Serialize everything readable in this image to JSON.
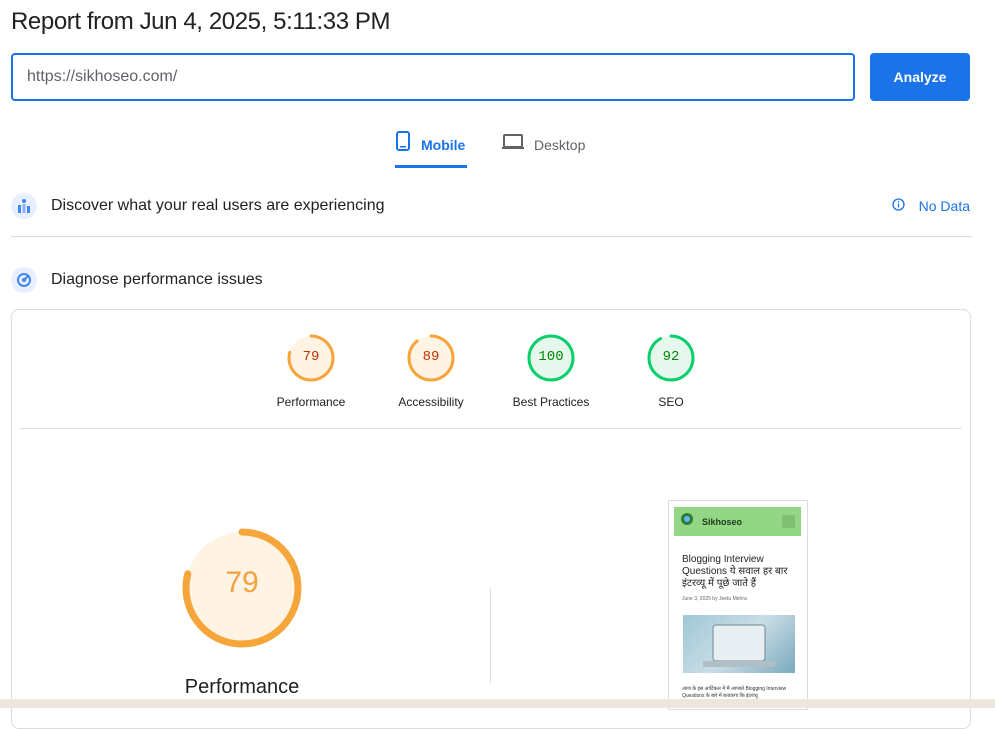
{
  "report": {
    "title": "Report from Jun 4, 2025, 5:11:33 PM",
    "url_value": "https://sikhoseo.com/",
    "analyze_label": "Analyze"
  },
  "tabs": [
    {
      "label": "Mobile",
      "icon": "mobile-icon",
      "active": true
    },
    {
      "label": "Desktop",
      "icon": "desktop-icon",
      "active": false
    }
  ],
  "field_data": {
    "title": "Discover what your real users are experiencing",
    "status": "No Data"
  },
  "diagnose": {
    "title": "Diagnose performance issues"
  },
  "categories": [
    {
      "label": "Performance",
      "score": "79",
      "value": 79,
      "color": "#f6a53a",
      "text_color": "#c33300",
      "bg": "#fff3e3"
    },
    {
      "label": "Accessibility",
      "score": "89",
      "value": 89,
      "color": "#f6a53a",
      "text_color": "#c33300",
      "bg": "#fff3e3"
    },
    {
      "label": "Best Practices",
      "score": "100",
      "value": 100,
      "color": "#0cce6b",
      "text_color": "#008800",
      "bg": "#e6f8ee"
    },
    {
      "label": "SEO",
      "score": "92",
      "value": 92,
      "color": "#0cce6b",
      "text_color": "#008800",
      "bg": "#e6f8ee"
    }
  ],
  "main_gauge": {
    "score": "79",
    "value": 79,
    "label": "Performance",
    "color": "#f6a53a"
  },
  "screenshot": {
    "brand": "Sikhoseo",
    "headline": "Blogging Interview Questions ये सवाल हर बार इंटरव्यू में पूछे जाते हैं",
    "meta": "June 3, 2025 by Jeetu Mehra",
    "body": "आज के इस आर्टिकल में मैं आपको Blogging Interview Questions के बारे में बताऊंगा कि इंटरव्यू"
  }
}
